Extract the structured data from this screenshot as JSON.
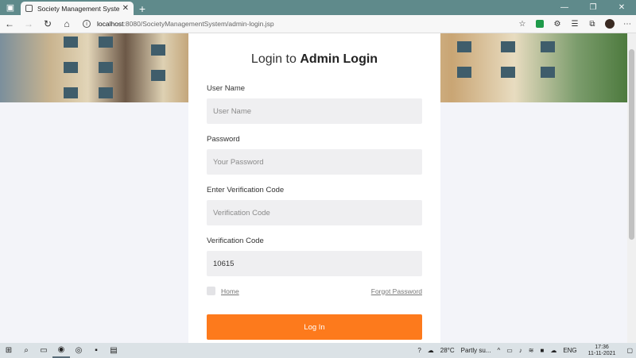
{
  "browser": {
    "tab_title": "Society Management System",
    "url_host": "localhost",
    "url_path": ":8080/SocietyManagementSystem/admin-login.jsp"
  },
  "login": {
    "heading_prefix": "Login to",
    "heading_bold": "Admin Login",
    "username_label": "User Name",
    "username_placeholder": "User Name",
    "password_label": "Password",
    "password_placeholder": "Your Password",
    "enter_code_label": "Enter Verification Code",
    "enter_code_placeholder": "Verification Code",
    "code_label": "Verification Code",
    "code_value": "10615",
    "home_link": "Home",
    "forgot_link": "Forgot Password",
    "submit_label": "Log In"
  },
  "taskbar": {
    "weather": "28°C",
    "weather_desc": "Partly su...",
    "lang": "ENG",
    "time": "17:36",
    "date": "11-11-2021"
  }
}
